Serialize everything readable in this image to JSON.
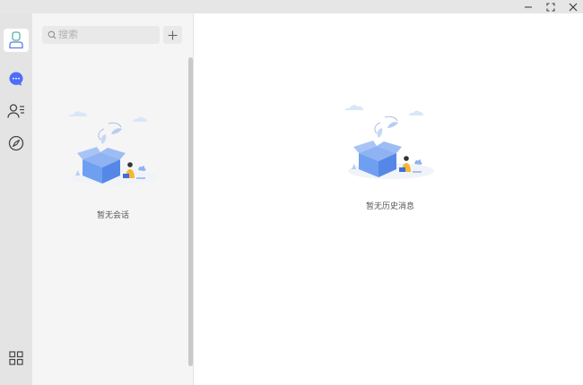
{
  "window": {
    "controls": [
      {
        "name": "minimize-icon"
      },
      {
        "name": "maximize-icon"
      },
      {
        "name": "close-icon"
      }
    ]
  },
  "rail": {
    "items": [
      {
        "name": "rail-item-profile",
        "icon": "user-card-icon",
        "active": true
      },
      {
        "name": "rail-item-messages",
        "icon": "chat-bubble-icon",
        "color": "#4f6ef7"
      },
      {
        "name": "rail-item-contacts",
        "icon": "contacts-icon"
      },
      {
        "name": "rail-item-discover",
        "icon": "compass-icon"
      }
    ],
    "bottom_item": {
      "name": "rail-item-apps",
      "icon": "grid-icon"
    }
  },
  "sidebar": {
    "search": {
      "placeholder": "搜索",
      "value": ""
    },
    "add_icon": "plus-icon",
    "empty_text": "暂无会话"
  },
  "main": {
    "empty_text": "暂无历史消息"
  },
  "colors": {
    "accent": "#4f6ef7",
    "illustration_blue": "#6f9ff0"
  }
}
